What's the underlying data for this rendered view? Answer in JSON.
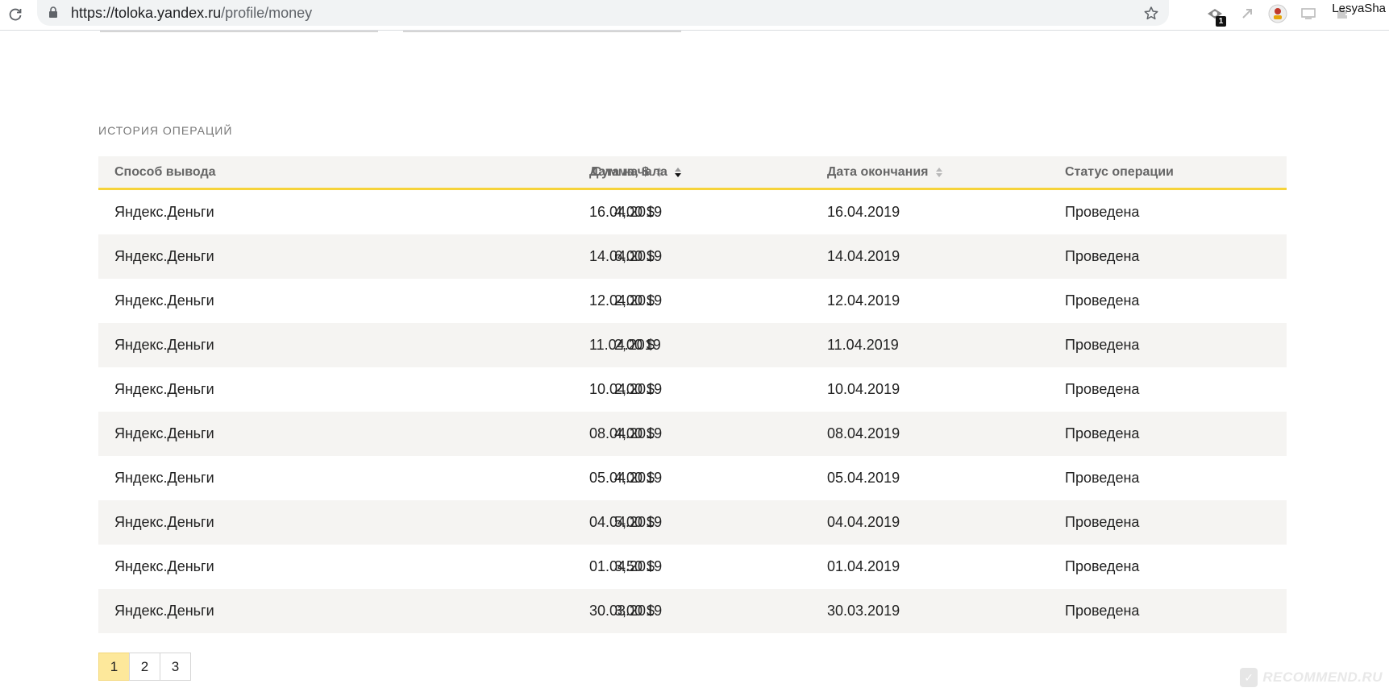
{
  "browser": {
    "url_host": "https://toloka.yandex.ru",
    "url_path": "/profile/money",
    "extension_badge": "1",
    "profile_name": "LesyaSha"
  },
  "section": {
    "title": "ИСТОРИЯ ОПЕРАЦИЙ"
  },
  "table": {
    "columns": {
      "method": "Способ вывода",
      "amount": "Сумма, $",
      "start": "Дата начала",
      "end": "Дата окончания",
      "status": "Статус операции"
    },
    "rows": [
      {
        "method": "Яндекс.Деньги",
        "amount": "4,00 $",
        "start": "16.04.2019",
        "end": "16.04.2019",
        "status": "Проведена"
      },
      {
        "method": "Яндекс.Деньги",
        "amount": "6,00 $",
        "start": "14.04.2019",
        "end": "14.04.2019",
        "status": "Проведена"
      },
      {
        "method": "Яндекс.Деньги",
        "amount": "2,00 $",
        "start": "12.04.2019",
        "end": "12.04.2019",
        "status": "Проведена"
      },
      {
        "method": "Яндекс.Деньги",
        "amount": "2,00 $",
        "start": "11.04.2019",
        "end": "11.04.2019",
        "status": "Проведена"
      },
      {
        "method": "Яндекс.Деньги",
        "amount": "2,00 $",
        "start": "10.04.2019",
        "end": "10.04.2019",
        "status": "Проведена"
      },
      {
        "method": "Яндекс.Деньги",
        "amount": "4,00 $",
        "start": "08.04.2019",
        "end": "08.04.2019",
        "status": "Проведена"
      },
      {
        "method": "Яндекс.Деньги",
        "amount": "4,00 $",
        "start": "05.04.2019",
        "end": "05.04.2019",
        "status": "Проведена"
      },
      {
        "method": "Яндекс.Деньги",
        "amount": "5,00 $",
        "start": "04.04.2019",
        "end": "04.04.2019",
        "status": "Проведена"
      },
      {
        "method": "Яндекс.Деньги",
        "amount": "3,50 $",
        "start": "01.04.2019",
        "end": "01.04.2019",
        "status": "Проведена"
      },
      {
        "method": "Яндекс.Деньги",
        "amount": "3,00 $",
        "start": "30.03.2019",
        "end": "30.03.2019",
        "status": "Проведена"
      }
    ]
  },
  "pagination": {
    "pages": [
      "1",
      "2",
      "3"
    ],
    "current": "1"
  },
  "watermark": {
    "text": "RECOMMEND.RU"
  },
  "colors": {
    "header_underline": "#f6d33a",
    "active_page": "#fde89b",
    "stripe": "#f5f4f2"
  }
}
